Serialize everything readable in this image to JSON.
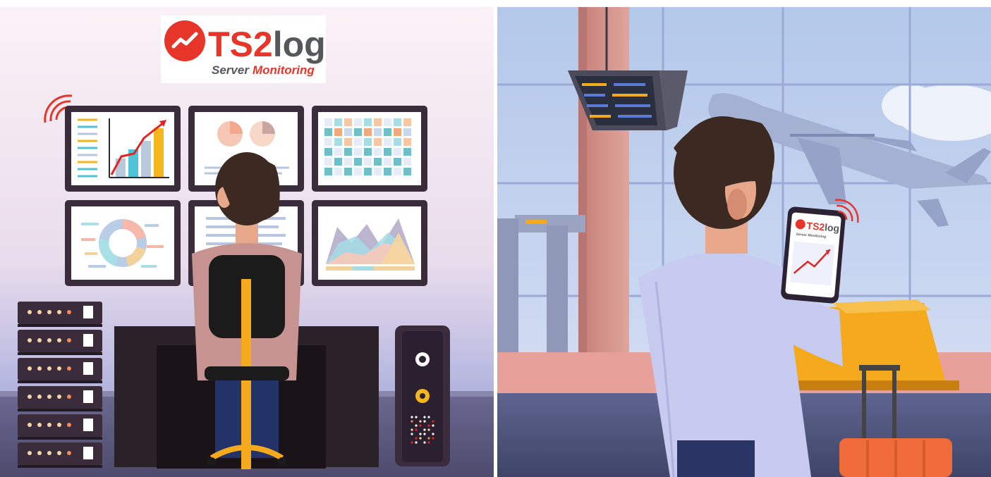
{
  "logo": {
    "brand_prefix": "TS2",
    "brand_suffix": "log",
    "tagline_part1": "Server",
    "tagline_part2": "Monitoring"
  },
  "phone_logo": {
    "brand_prefix": "TS2",
    "brand_suffix": "log",
    "tagline": "Server Monitoring"
  },
  "colors": {
    "brand_red": "#e8352a",
    "brand_gray": "#55575a",
    "monitor_frame": "#3a2c3a",
    "chair_orange": "#f5a91d",
    "sky_blue": "#bcd0ee"
  },
  "icons": [
    "wifi-signal-icon",
    "trend-line-icon"
  ]
}
